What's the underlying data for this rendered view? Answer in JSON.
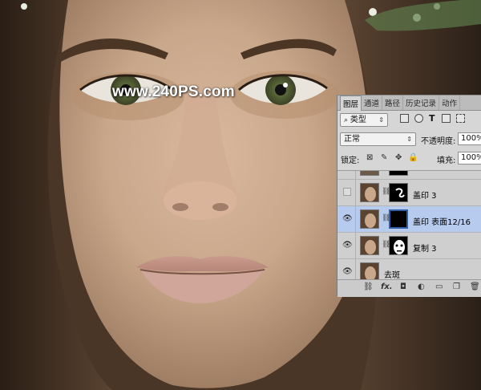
{
  "watermark": "www.240PS.com",
  "colors": {
    "selected_row": "#b7cbee",
    "panel_bg": "#d6d6d6",
    "tab_bar": "#bcbcbc"
  },
  "panel": {
    "tabs": [
      "图层",
      "通道",
      "路径",
      "历史记录",
      "动作"
    ],
    "filter_select": "类型",
    "blend_mode": "正常",
    "opacity_label": "不透明度:",
    "opacity_value": "100%",
    "lock_label": "锁定:",
    "fill_label": "填充:",
    "fill_value": "100%",
    "layers": [
      {
        "name": "",
        "visible": false,
        "has_mask": true,
        "selected": false
      },
      {
        "name": "盖印 3",
        "visible": false,
        "has_mask": true,
        "selected": false
      },
      {
        "name": "盖印 表面12/16",
        "visible": true,
        "has_mask": true,
        "selected": true
      },
      {
        "name": "复制 3",
        "visible": true,
        "has_mask": true,
        "selected": false
      },
      {
        "name": "去斑",
        "visible": true,
        "has_mask": false,
        "selected": false
      }
    ],
    "bottom_fx": "fx."
  },
  "icons": {
    "search": "search-icon",
    "eye": "eye-icon",
    "chain": "link-icon",
    "trash": "trash-icon",
    "folder": "folder-icon",
    "new_layer": "new-layer-icon"
  }
}
